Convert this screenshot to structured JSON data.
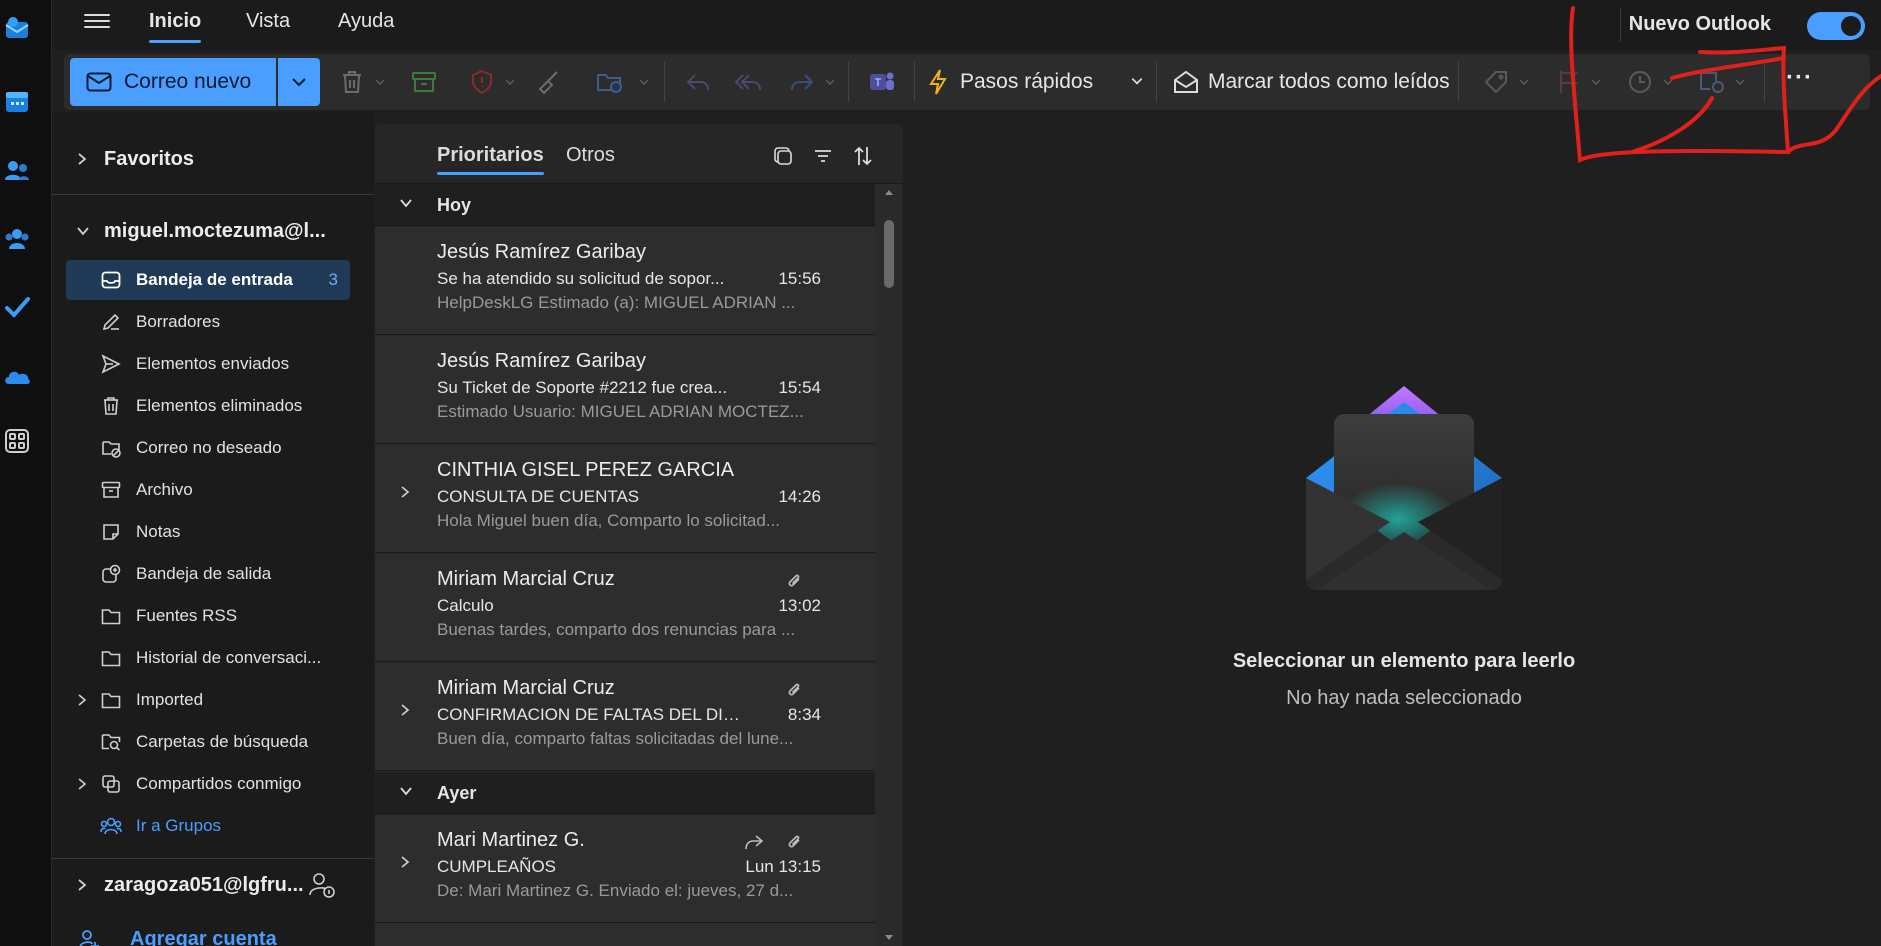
{
  "colors": {
    "accent": "#4a9eff",
    "selected_folder_bg": "#1e3a56",
    "annotation": "#e0201b"
  },
  "app_rail": {
    "icons": [
      "outlook-mail-icon",
      "calendar-icon",
      "people-icon",
      "groups-icon",
      "todo-check-icon",
      "onedrive-cloud-icon",
      "apps-grid-icon"
    ]
  },
  "top_tabs": {
    "inicio": "Inicio",
    "vista": "Vista",
    "ayuda": "Ayuda"
  },
  "nuevo_outlook": {
    "label": "Nuevo Outlook",
    "toggle_on": true
  },
  "ribbon": {
    "new_mail": "Correo nuevo",
    "quick_steps": "Pasos rápidos",
    "mark_all_read": "Marcar todos como leídos",
    "more": "···"
  },
  "folder_pane": {
    "favorites": "Favoritos",
    "account1": "miguel.moctezuma@l...",
    "folders": [
      {
        "name": "Bandeja de entrada",
        "count": "3",
        "icon": "inbox-icon"
      },
      {
        "name": "Borradores",
        "count": "",
        "icon": "pencil-icon"
      },
      {
        "name": "Elementos enviados",
        "count": "",
        "icon": "send-icon"
      },
      {
        "name": "Elementos eliminados",
        "count": "",
        "icon": "trash-icon"
      },
      {
        "name": "Correo no deseado",
        "count": "",
        "icon": "junk-icon"
      },
      {
        "name": "Archivo",
        "count": "",
        "icon": "archive-icon"
      },
      {
        "name": "Notas",
        "count": "",
        "icon": "note-icon"
      },
      {
        "name": "Bandeja de salida",
        "count": "",
        "icon": "outbox-icon"
      },
      {
        "name": "Fuentes RSS",
        "count": "",
        "icon": "folder-icon"
      },
      {
        "name": "Historial de conversaci...",
        "count": "",
        "icon": "folder-icon"
      },
      {
        "name": "Imported",
        "count": "",
        "icon": "folder-icon"
      },
      {
        "name": "Carpetas de búsqueda",
        "count": "",
        "icon": "search-folder-icon"
      },
      {
        "name": "Compartidos conmigo",
        "count": "",
        "icon": "shared-icon"
      },
      {
        "name": "Ir a Grupos",
        "count": "",
        "icon": "groups-icon"
      }
    ],
    "account2": "zaragoza051@lgfru...",
    "add_account": "Agregar cuenta"
  },
  "message_list": {
    "tab_focused": "Prioritarios",
    "tab_other": "Otros",
    "group_today": "Hoy",
    "group_yesterday": "Ayer",
    "messages": [
      {
        "sender": "Jesús Ramírez Garibay",
        "subject": "Se ha atendido su solicitud de sopor...",
        "time": "15:56",
        "preview": "HelpDeskLG Estimado (a): MIGUEL ADRIAN ..."
      },
      {
        "sender": "Jesús Ramírez Garibay",
        "subject": "Su Ticket de Soporte #2212 fue crea...",
        "time": "15:54",
        "preview": "Estimado Usuario: MIGUEL ADRIAN MOCTEZ..."
      },
      {
        "sender": "CINTHIA GISEL PEREZ GARCIA",
        "subject": "CONSULTA DE CUENTAS",
        "time": "14:26",
        "preview": "Hola Miguel buen día, Comparto lo solicitad..."
      },
      {
        "sender": "Miriam Marcial Cruz",
        "subject": "Calculo",
        "time": "13:02",
        "preview": "Buenas tardes, comparto dos renuncias para ..."
      },
      {
        "sender": "Miriam Marcial Cruz",
        "subject": "CONFIRMACION DE FALTAS DEL DIA ...",
        "time": "8:34",
        "preview": "Buen día, comparto faltas solicitadas del lune..."
      },
      {
        "sender": "Mari Martinez G.",
        "subject": "CUMPLEAÑOS",
        "time": "Lun 13:15",
        "preview": "De: Mari Martinez G. Enviado el: jueves, 27 d..."
      }
    ]
  },
  "reading_pane": {
    "title": "Seleccionar un elemento para leerlo",
    "subtitle": "No hay nada seleccionado"
  }
}
